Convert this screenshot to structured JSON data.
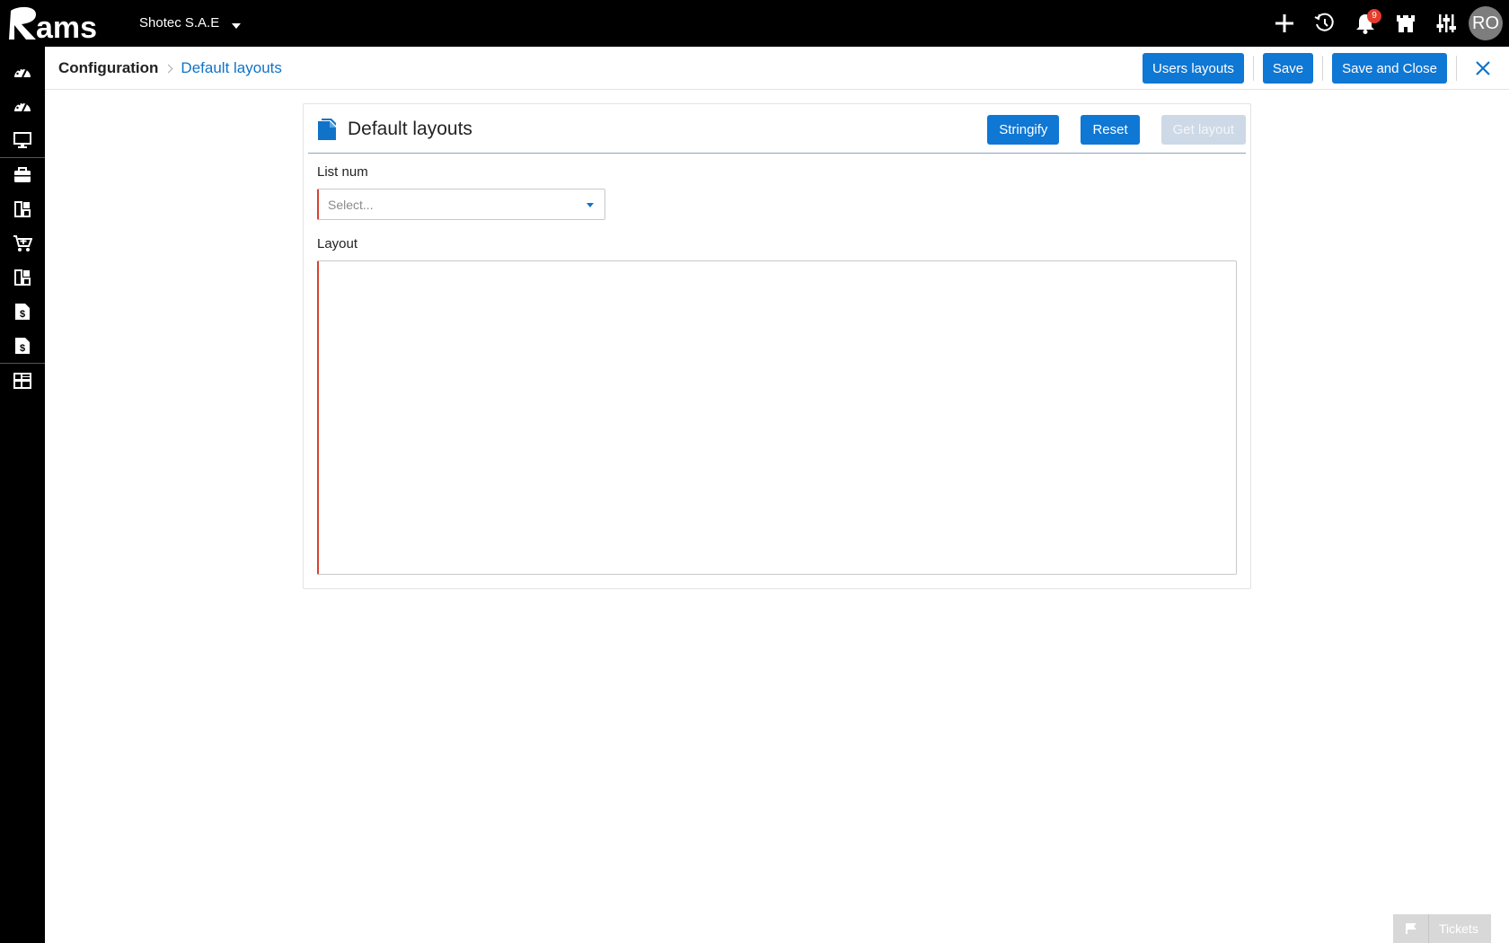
{
  "app": {
    "logo_text": "Rams",
    "company": "Shotec S.A.E",
    "notifications_count": "9",
    "user_initials": "RO"
  },
  "top_icons": [
    "plus-icon",
    "history-icon",
    "bell-icon",
    "castle-icon",
    "sliders-icon"
  ],
  "sidebar": {
    "items": [
      "dashboard-icon",
      "dashboard-alt-icon",
      "monitor-icon",
      "briefcase-icon",
      "modules-icon",
      "cart-icon",
      "modules-alt-icon",
      "invoice-icon",
      "invoice-alt-icon",
      "configuration-icon"
    ]
  },
  "breadcrumb": {
    "root": "Configuration",
    "current": "Default layouts"
  },
  "header_actions": {
    "users_layouts": "Users layouts",
    "save": "Save",
    "save_and_close": "Save and Close"
  },
  "panel": {
    "title": "Default layouts",
    "stringify": "Stringify",
    "reset": "Reset",
    "get_layout": "Get layout",
    "list_num_label": "List num",
    "list_num_placeholder": "Select...",
    "layout_label": "Layout",
    "layout_value": ""
  },
  "tickets": {
    "label": "Tickets"
  },
  "colors": {
    "primary": "#0f77d4",
    "required_border": "#d9402f",
    "disabled_button": "#cdd9e6",
    "badge": "#e53b2c"
  }
}
